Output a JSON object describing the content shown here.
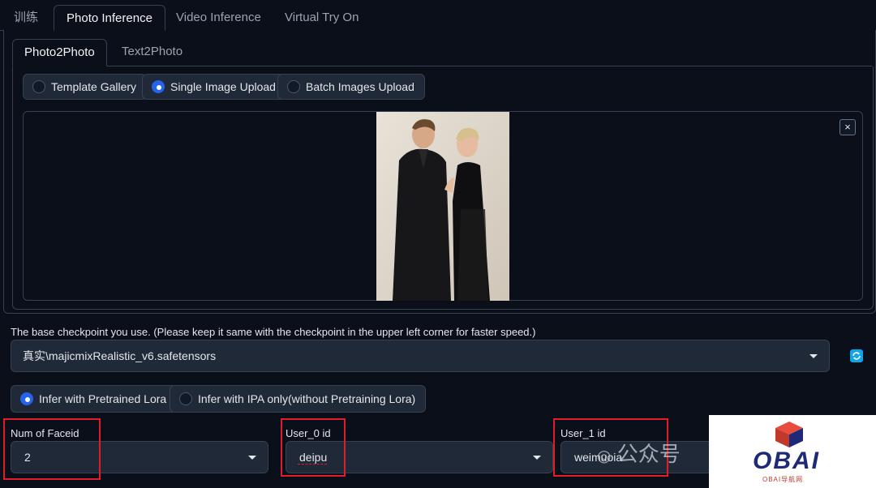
{
  "top_tabs": [
    {
      "label": "训练"
    },
    {
      "label": "Photo Inference"
    },
    {
      "label": "Video Inference"
    },
    {
      "label": "Virtual Try On"
    }
  ],
  "sub_tabs": [
    {
      "label": "Photo2Photo"
    },
    {
      "label": "Text2Photo"
    }
  ],
  "upload_mode": {
    "options": [
      "Template Gallery",
      "Single Image Upload",
      "Batch Images Upload"
    ],
    "selected": "Single Image Upload"
  },
  "upload": {
    "close_label": "×"
  },
  "checkpoint": {
    "label": "The base checkpoint you use. (Please keep it same with the checkpoint in the upper left corner for faster speed.)",
    "value": "真实\\majicmixRealistic_v6.safetensors"
  },
  "infer_mode": {
    "options": [
      "Infer with Pretrained Lora",
      "Infer with IPA only(without Pretraining Lora)"
    ],
    "selected": "Infer with Pretrained Lora"
  },
  "faceid": {
    "label": "Num of Faceid",
    "value": "2"
  },
  "user0": {
    "label": "User_0 id",
    "value": "deipu"
  },
  "user1": {
    "label": "User_1 id",
    "value": "weimuoia"
  },
  "watermark": {
    "text": "公众号"
  },
  "logo": {
    "text": "OBAI",
    "subtitle": "OBAI导航网"
  },
  "colors": {
    "background": "#0b0f19",
    "accent": "#2563eb",
    "highlight": "#e11d2a"
  }
}
